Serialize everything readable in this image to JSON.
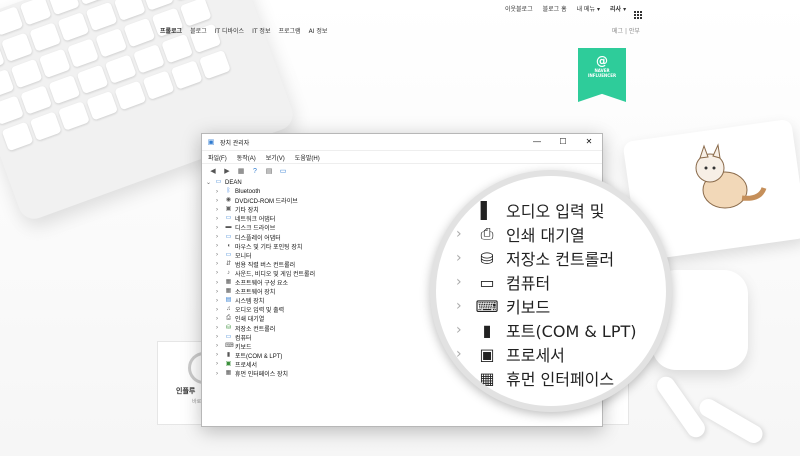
{
  "blog_nav": {
    "top_links": [
      "이웃블로그",
      "블로그 홈",
      "내 메뉴 ▾",
      "리사 ▾"
    ],
    "menu": [
      "프롤로그",
      "블로그",
      "IT 디바이스",
      "IT 정보",
      "프로그램",
      "AI 정보"
    ],
    "active_menu_index": 0,
    "submenu": "메그 | 안부"
  },
  "badge": {
    "line1": "NAVER",
    "line2": "INFLUENCER"
  },
  "bottom_card": {
    "label": "인플루",
    "sub": "바로"
  },
  "window": {
    "title": "장치 관리자",
    "controls": {
      "minimize": "—",
      "maximize": "☐",
      "close": "✕"
    },
    "menu": [
      "파일(F)",
      "동작(A)",
      "보기(V)",
      "도움말(H)"
    ],
    "root": "DEAN",
    "items": [
      {
        "label": "Bluetooth",
        "icon": "bluetooth-icon",
        "glyph": "ᛒ",
        "color": "#1e6fd9"
      },
      {
        "label": "DVD/CD-ROM 드라이브",
        "icon": "disc-drive-icon",
        "glyph": "◉",
        "color": "#555"
      },
      {
        "label": "기타 장치",
        "icon": "other-device-icon",
        "glyph": "▣",
        "color": "#666"
      },
      {
        "label": "네트워크 어댑터",
        "icon": "network-icon",
        "glyph": "▭",
        "color": "#2f7bd0"
      },
      {
        "label": "디스크 드라이브",
        "icon": "disk-icon",
        "glyph": "▬",
        "color": "#555"
      },
      {
        "label": "디스플레이 어댑터",
        "icon": "display-adapter-icon",
        "glyph": "▭",
        "color": "#2f7bd0"
      },
      {
        "label": "마우스 및 기타 포인팅 장치",
        "icon": "mouse-icon",
        "glyph": "◖",
        "color": "#555"
      },
      {
        "label": "모니터",
        "icon": "monitor-icon",
        "glyph": "▭",
        "color": "#2f7bd0"
      },
      {
        "label": "범용 직렬 버스 컨트롤러",
        "icon": "usb-icon",
        "glyph": "⇵",
        "color": "#555"
      },
      {
        "label": "사운드, 비디오 및 게임 컨트롤러",
        "icon": "sound-icon",
        "glyph": "♪",
        "color": "#555"
      },
      {
        "label": "소프트웨어 구성 요소",
        "icon": "software-component-icon",
        "glyph": "▦",
        "color": "#555"
      },
      {
        "label": "소프트웨어 장치",
        "icon": "software-device-icon",
        "glyph": "▦",
        "color": "#555"
      },
      {
        "label": "시스템 장치",
        "icon": "system-device-icon",
        "glyph": "▤",
        "color": "#2f7bd0"
      },
      {
        "label": "오디오 입력 및 출력",
        "icon": "audio-icon",
        "glyph": "♫",
        "color": "#555"
      },
      {
        "label": "인쇄 대기열",
        "icon": "printer-icon",
        "glyph": "⎙",
        "color": "#555"
      },
      {
        "label": "저장소 컨트롤러",
        "icon": "storage-icon",
        "glyph": "⛁",
        "color": "#3a8f3a"
      },
      {
        "label": "컴퓨터",
        "icon": "computer-icon",
        "glyph": "▭",
        "color": "#2f7bd0"
      },
      {
        "label": "키보드",
        "icon": "keyboard-icon",
        "glyph": "⌨",
        "color": "#555"
      },
      {
        "label": "포트(COM & LPT)",
        "icon": "port-icon",
        "glyph": "▮",
        "color": "#555"
      },
      {
        "label": "프로세서",
        "icon": "processor-icon",
        "glyph": "▣",
        "color": "#3a8f3a"
      },
      {
        "label": "휴먼 인터페이스 장치",
        "icon": "hid-icon",
        "glyph": "▦",
        "color": "#555"
      }
    ]
  },
  "magnifier": {
    "items": [
      {
        "label": "오디오 입력 및",
        "icon": "audio-icon",
        "glyph": "▌"
      },
      {
        "label": "인쇄 대기열",
        "icon": "printer-icon",
        "glyph": "⎙"
      },
      {
        "label": "저장소 컨트롤러",
        "icon": "storage-icon",
        "glyph": "⛁"
      },
      {
        "label": "컴퓨터",
        "icon": "computer-icon",
        "glyph": "▭"
      },
      {
        "label": "키보드",
        "icon": "keyboard-icon",
        "glyph": "⌨"
      },
      {
        "label": "포트(COM & LPT)",
        "icon": "port-icon",
        "glyph": "▮"
      },
      {
        "label": "프로세서",
        "icon": "processor-icon",
        "glyph": "▣"
      },
      {
        "label": "휴먼 인터페이스",
        "icon": "hid-icon",
        "glyph": "▦"
      }
    ]
  }
}
